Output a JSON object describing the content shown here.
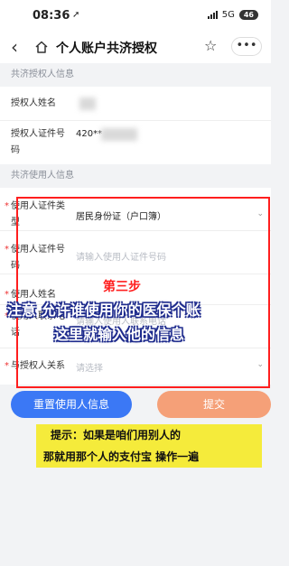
{
  "status_bar": {
    "time": "08:36",
    "location_arrow": "➚",
    "network": "5G",
    "battery": "46"
  },
  "nav": {
    "back_glyph": "‹",
    "title": "个人账户共济授权",
    "star_glyph": "☆",
    "more_glyph": "•••"
  },
  "grantor_section": {
    "header": "共济授权人信息",
    "name_label": "授权人姓名",
    "id_label": "授权人证件号码",
    "id_value_partial": "420**"
  },
  "user_section": {
    "header": "共济使用人信息",
    "id_type_label": "使用人证件类型",
    "id_type_value": "居民身份证（户口簿）",
    "id_no_label": "使用人证件号码",
    "id_no_placeholder": "请输入使用人证件号码",
    "name_label": "使用人姓名",
    "phone_label": "使用人联系电话",
    "phone_placeholder": "请输入使用人联系电话",
    "relation_label": "与授权人关系",
    "relation_placeholder": "请选择"
  },
  "buttons": {
    "reset": "重置使用人信息",
    "submit": "提交"
  },
  "overlay": {
    "step": "第三步",
    "line1": "注意 允许谁使用你的医保个账",
    "line2": "这里就输入他的信息",
    "tip_line1": "提示：如果是咱们用别人的",
    "tip_line2": "那就用那个人的支付宝 操作一遍"
  },
  "colors": {
    "primary_blue": "#3b78f5",
    "submit_orange": "#f5a078",
    "highlight_red": "#ff1e1e",
    "tip_yellow": "#f5eb3b"
  }
}
